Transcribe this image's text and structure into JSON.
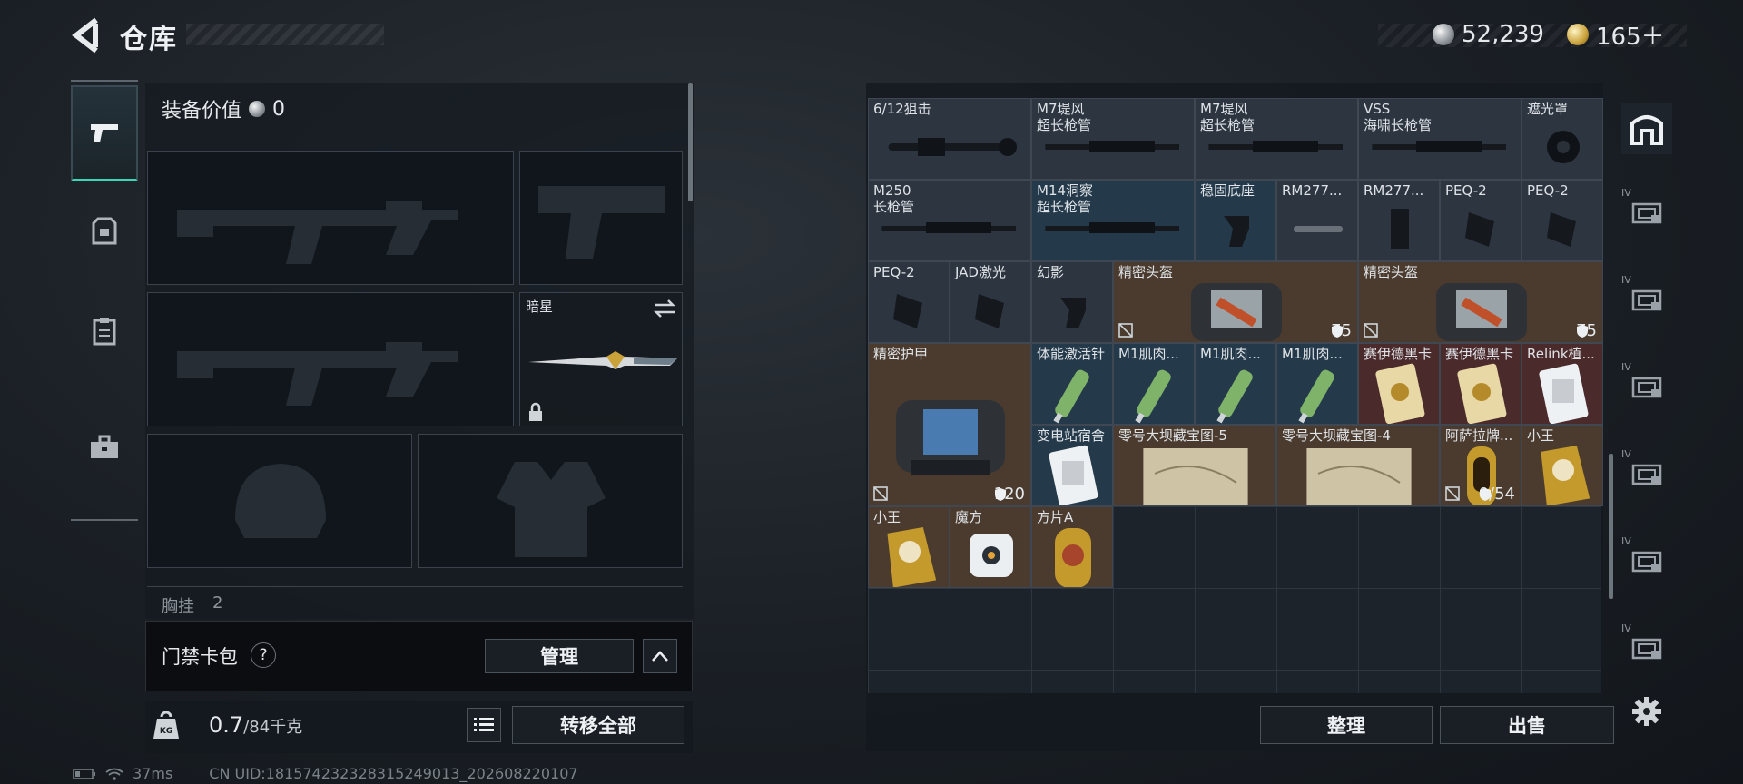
{
  "header": {
    "title": "仓库",
    "currency_silver": "52,239",
    "currency_gold": "165＋"
  },
  "loadout": {
    "equip_value_label": "装备价值",
    "equip_value": "0",
    "melee_name": "暗星",
    "chest_rig_label": "胸挂",
    "chest_rig_count": "2"
  },
  "keycard": {
    "label": "门禁卡包",
    "help": "?",
    "manage_label": "管理"
  },
  "weight": {
    "current": "0.7",
    "capacity": "/84千克",
    "transfer_all_label": "转移全部"
  },
  "status_bar": {
    "ping": "37ms",
    "uid": "CN UID:18157423232831524901​3_202608220107"
  },
  "inventory": {
    "items": [
      {
        "name": "6/12狙击",
        "color": "grey"
      },
      {
        "name": "M7堤风\n超长枪管",
        "color": "grey"
      },
      {
        "name": "M7堤风\n超长枪管",
        "color": "grey"
      },
      {
        "name": "VSS\n海啸长枪管",
        "color": "grey"
      },
      {
        "name": "遮光罩",
        "color": "grey"
      },
      {
        "name": "M250\n长枪管",
        "color": "grey"
      },
      {
        "name": "M14洞察\n超长枪管",
        "color": "blue"
      },
      {
        "name": "稳固底座",
        "color": "blue"
      },
      {
        "name": "RM277...",
        "color": "grey"
      },
      {
        "name": "RM277...",
        "color": "grey"
      },
      {
        "name": "PEQ-2",
        "color": "grey"
      },
      {
        "name": "PEQ-2",
        "color": "grey"
      },
      {
        "name": "PEQ-2",
        "color": "grey"
      },
      {
        "name": "JAD激光",
        "color": "grey"
      },
      {
        "name": "幻影",
        "color": "grey"
      },
      {
        "name": "精密头盔",
        "color": "brown",
        "durability": "75"
      },
      {
        "name": "精密头盔",
        "color": "brown",
        "durability": "75"
      },
      {
        "name": "精密护甲",
        "color": "brown",
        "durability": "120"
      },
      {
        "name": "体能激活针",
        "color": "blue"
      },
      {
        "name": "M1肌肉...",
        "color": "blue"
      },
      {
        "name": "M1肌肉...",
        "color": "blue"
      },
      {
        "name": "M1肌肉...",
        "color": "blue"
      },
      {
        "name": "赛伊德黑卡",
        "color": "red"
      },
      {
        "name": "赛伊德黑卡",
        "color": "red"
      },
      {
        "name": "Relink植...",
        "color": "red"
      },
      {
        "name": "变电站宿舍",
        "color": "blue"
      },
      {
        "name": "零号大坝藏宝图-5",
        "color": "brown"
      },
      {
        "name": "零号大坝藏宝图-4",
        "color": "brown"
      },
      {
        "name": "阿萨拉牌...",
        "color": "brown",
        "durability": "0/54"
      },
      {
        "name": "小王",
        "color": "brown"
      },
      {
        "name": "小王",
        "color": "brown"
      },
      {
        "name": "魔方",
        "color": "brown"
      },
      {
        "name": "方片A",
        "color": "brown"
      }
    ],
    "sort_label": "整理",
    "sell_label": "出售"
  },
  "right_rail": {
    "tab_labels": [
      "IV",
      "IV",
      "IV",
      "IV",
      "IV",
      "IV"
    ]
  },
  "colors": {
    "accent": "#39d7b8",
    "rarity_grey": "#2d3541",
    "rarity_blue": "#243a4a",
    "rarity_gold": "#4a3b2e",
    "rarity_red": "#4b2a2c"
  }
}
